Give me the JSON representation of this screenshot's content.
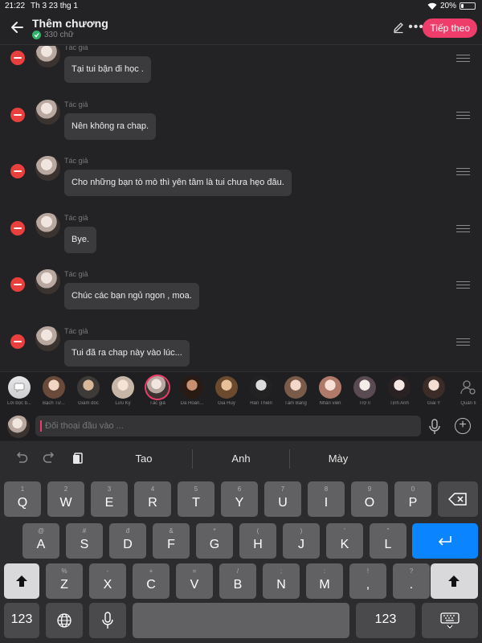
{
  "status": {
    "time": "21:22",
    "date": "Th 3 23 thg 1",
    "battery": "20%",
    "battery_level": 0.2
  },
  "header": {
    "title": "Thêm chương",
    "word_count": "330 chữ",
    "next_label": "Tiếp theo"
  },
  "messages": [
    {
      "author": "Tác giả",
      "text": "Tại tui bận đi học ."
    },
    {
      "author": "Tác giả",
      "text": "Nên không ra chap."
    },
    {
      "author": "Tác giả",
      "text": "Cho những bạn tò mò thì yên tâm là tui chưa hẹo đâu."
    },
    {
      "author": "Tác giả",
      "text": "Bye."
    },
    {
      "author": "Tác giả",
      "text": "Chúc các bạn ngủ ngon , moa."
    },
    {
      "author": "Tác giả",
      "text": "Tui đã ra chap này vào lúc..."
    }
  ],
  "characters": [
    {
      "name": "Lời bộc b..."
    },
    {
      "name": "Bạch Tư..."
    },
    {
      "name": "Giám đốc"
    },
    {
      "name": "Lưu Kỳ"
    },
    {
      "name": "Tác giả"
    },
    {
      "name": "Da Hoàn..."
    },
    {
      "name": "Gia Huy"
    },
    {
      "name": "Hàn Thiên"
    },
    {
      "name": "Tâm Băng"
    },
    {
      "name": "Nhân viên"
    },
    {
      "name": "Trợ lí"
    },
    {
      "name": "Tịnh Anh"
    },
    {
      "name": "Giai Y"
    },
    {
      "name": "Quản lí"
    }
  ],
  "input": {
    "placeholder": "Đối thoại đầu vào ..."
  },
  "suggestions": [
    "Tao",
    "Anh",
    "Mày"
  ],
  "keyboard": {
    "row1": [
      [
        "1",
        "Q"
      ],
      [
        "2",
        "W"
      ],
      [
        "3",
        "E"
      ],
      [
        "4",
        "R"
      ],
      [
        "5",
        "T"
      ],
      [
        "6",
        "Y"
      ],
      [
        "7",
        "U"
      ],
      [
        "8",
        "I"
      ],
      [
        "9",
        "O"
      ],
      [
        "0",
        "P"
      ]
    ],
    "row2": [
      [
        "@",
        "A"
      ],
      [
        "#",
        "S"
      ],
      [
        "đ",
        "D"
      ],
      [
        "&",
        "F"
      ],
      [
        "*",
        "G"
      ],
      [
        "(",
        "H"
      ],
      [
        ")",
        "J"
      ],
      [
        "'",
        "K"
      ],
      [
        "\"",
        "L"
      ]
    ],
    "row3": [
      [
        "%",
        "Z"
      ],
      [
        "-",
        "X"
      ],
      [
        "+",
        "C"
      ],
      [
        "=",
        "V"
      ],
      [
        "/",
        "B"
      ],
      [
        ";",
        "N"
      ],
      [
        ":",
        "M"
      ],
      [
        "!",
        ","
      ],
      [
        "?",
        "."
      ]
    ],
    "num_label": "123"
  },
  "colors": {
    "accent": "#ee3d6a",
    "delete": "#e9403e",
    "return_key": "#0a84ff",
    "verified": "#2fb36b"
  },
  "icons": [
    "back-arrow-icon",
    "pencil-icon",
    "more-icon",
    "check-icon",
    "delete-icon",
    "drag-handle-icon",
    "undo-icon",
    "redo-icon",
    "clipboard-icon",
    "microphone-icon",
    "plus-icon",
    "globe-icon",
    "keyboard-hide-icon",
    "backspace-icon",
    "return-icon",
    "shift-icon",
    "wifi-icon",
    "battery-icon"
  ]
}
